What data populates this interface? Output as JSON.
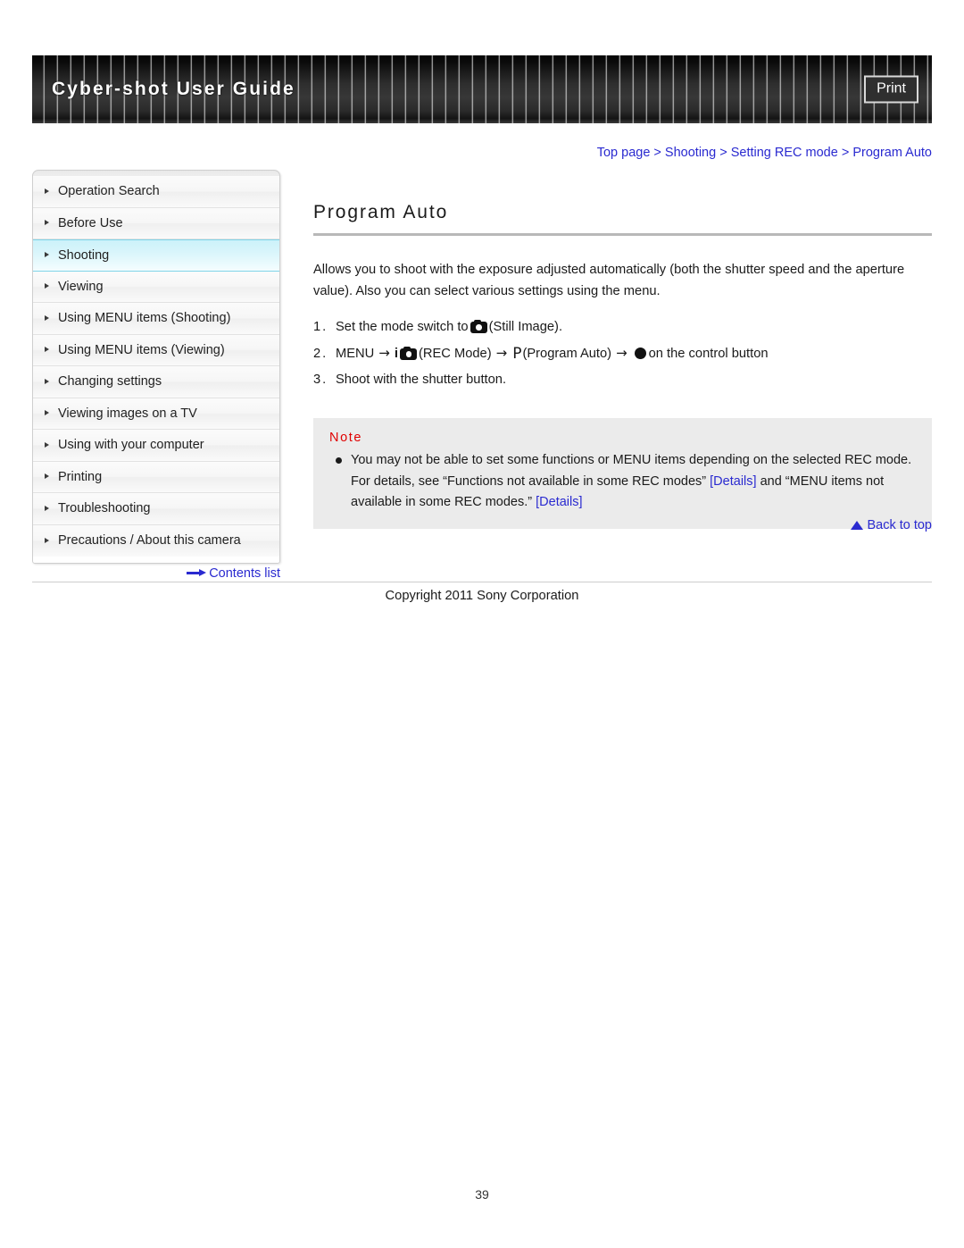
{
  "header": {
    "title": "Cyber-shot User Guide",
    "print_label": "Print"
  },
  "breadcrumb": {
    "items": [
      "Top page",
      "Shooting",
      "Setting REC mode",
      "Program Auto"
    ],
    "separator": ">",
    "full_text": "Top page > Shooting > Setting REC mode > Program Auto"
  },
  "sidebar": {
    "items": [
      {
        "label": "Operation Search",
        "active": false
      },
      {
        "label": "Before Use",
        "active": false
      },
      {
        "label": "Shooting",
        "active": true
      },
      {
        "label": "Viewing",
        "active": false
      },
      {
        "label": "Using MENU items (Shooting)",
        "active": false
      },
      {
        "label": "Using MENU items (Viewing)",
        "active": false
      },
      {
        "label": "Changing settings",
        "active": false
      },
      {
        "label": "Viewing images on a TV",
        "active": false
      },
      {
        "label": "Using with your computer",
        "active": false
      },
      {
        "label": "Printing",
        "active": false
      },
      {
        "label": "Troubleshooting",
        "active": false
      },
      {
        "label": "Precautions / About this camera",
        "active": false
      }
    ],
    "contents_list_label": "Contents list",
    "contents_list_icon": "arrow-right-icon"
  },
  "main": {
    "title": "Program Auto",
    "lead": "Allows you to shoot with the exposure adjusted automatically (both the shutter speed and the aperture value). Also you can select various settings using the menu.",
    "steps": [
      {
        "number": "1.",
        "parts": [
          {
            "type": "text",
            "value": "Set the mode switch to "
          },
          {
            "type": "icon",
            "value": "camera-icon"
          },
          {
            "type": "text",
            "value": "(Still Image)."
          }
        ],
        "plain": "Set the mode switch to (Still Image)."
      },
      {
        "number": "2.",
        "parts": [
          {
            "type": "text",
            "value": "MENU"
          },
          {
            "type": "icon",
            "value": "arrow-right-icon"
          },
          {
            "type": "icon",
            "value": "i-camera-icon"
          },
          {
            "type": "text",
            "value": "(REC Mode)"
          },
          {
            "type": "icon",
            "value": "arrow-right-icon"
          },
          {
            "type": "icon",
            "value": "p-mode-icon"
          },
          {
            "type": "text",
            "value": "(Program Auto)"
          },
          {
            "type": "icon",
            "value": "arrow-right-icon"
          },
          {
            "type": "icon",
            "value": "filled-circle-icon"
          },
          {
            "type": "text",
            "value": "on the control button"
          }
        ],
        "plain": "MENU → (REC Mode) → (Program Auto) → on the control button"
      },
      {
        "number": "3.",
        "parts": [
          {
            "type": "text",
            "value": "Shoot with the shutter button."
          }
        ],
        "plain": "Shoot with the shutter button."
      }
    ],
    "step1_text_before": "Set the mode switch to",
    "step1_text_after": "(Still Image).",
    "step2_menu": "MENU",
    "step2_rec_mode": "(REC Mode)",
    "step2_program_auto": "(Program Auto)",
    "step2_control": "on the control button",
    "step2_i_glyph": "i",
    "step2_p_glyph": "P",
    "step3_text": "Shoot with the shutter button.",
    "arrow_glyph": "→"
  },
  "note": {
    "title": "Note",
    "text_1": "You may not be able to set some functions or MENU items depending on the selected REC mode. For details, see “Functions not available in some REC modes” ",
    "link_1": "[Details]",
    "text_2": " and “MENU items not available in some REC modes.” ",
    "link_2": "[Details]"
  },
  "back_to_top": {
    "label": "Back to top",
    "icon": "triangle-up-icon"
  },
  "footer": {
    "copyright": "Copyright 2011 Sony Corporation",
    "page_number": "39"
  },
  "colors": {
    "link": "#2a2ad0",
    "note_title": "#e00000",
    "active_nav_bg": "#d9f5fb",
    "active_nav_border": "#7fd4e8",
    "note_bg": "#ebebeb",
    "banner_dark": "#2e2e2e"
  }
}
